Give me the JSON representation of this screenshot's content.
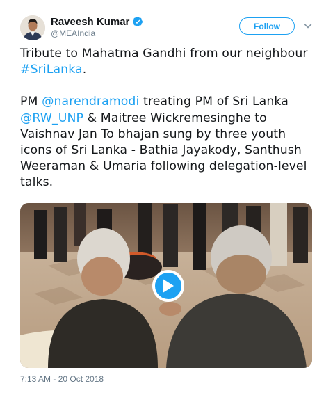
{
  "author": {
    "name": "Raveesh Kumar",
    "handle": "@MEAIndia",
    "verified": true
  },
  "follow_label": "Follow",
  "tweet": {
    "para1": {
      "text": "Tribute to Mahatma Gandhi from our neighbour ",
      "hashtag": "#SriLanka",
      "end": "."
    },
    "para2": {
      "pre": "PM ",
      "mention1": "@narendramodi",
      "mid1": " treating PM of Sri Lanka ",
      "mention2": "@RW_UNP",
      "rest": " & Maitree Wickremesinghe to Vaishnav Jan To bhajan sung by three youth icons of Sri Lanka - Bathia Jayakody, Santhush Weeraman & Umaria following delegation-level talks."
    }
  },
  "media": {
    "type": "video",
    "play_icon": "play-icon"
  },
  "timestamp": "7:13 AM - 20 Oct 2018",
  "colors": {
    "accent": "#1da1f2",
    "text": "#14171a",
    "secondary": "#657786"
  }
}
